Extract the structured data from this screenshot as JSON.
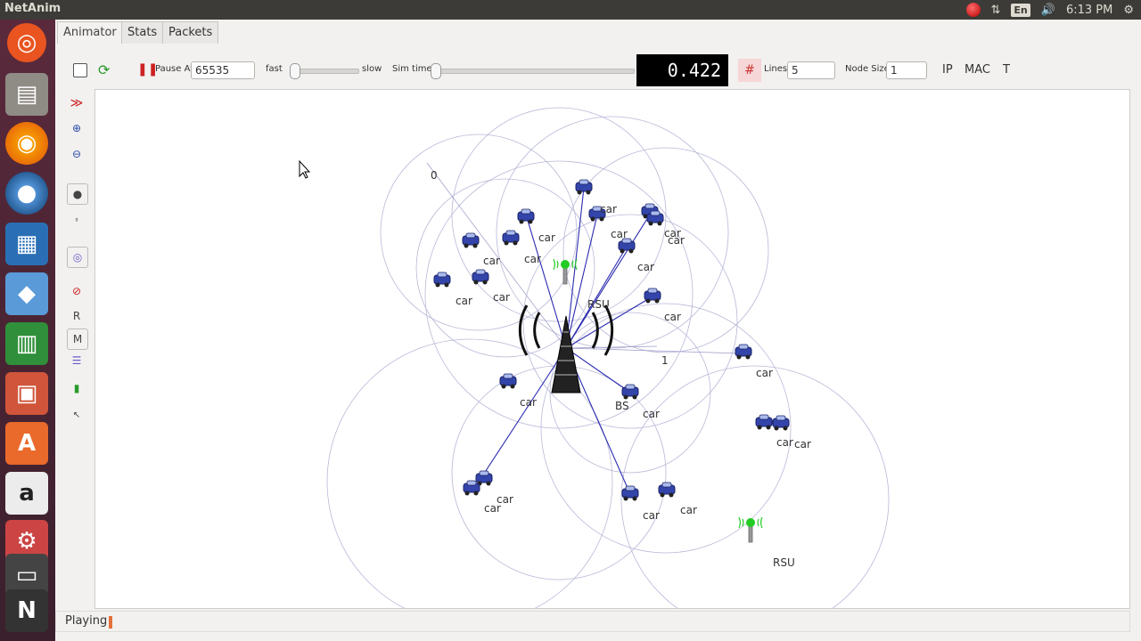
{
  "app": {
    "title": "NetAnim"
  },
  "tray": {
    "lang": "En",
    "time": "6:13 PM"
  },
  "tabs": [
    {
      "label": "Animator"
    },
    {
      "label": "Stats"
    },
    {
      "label": "Packets"
    }
  ],
  "toolbar": {
    "pause_at_label": "Pause At",
    "pause_at_value": "65535",
    "fast_label": "fast",
    "slow_label": "slow",
    "sim_time_label": "Sim time",
    "sim_time_value": "0.422",
    "lines_label": "Lines",
    "lines_value": "5",
    "node_size_label": "Node Size",
    "node_size_value": "1",
    "ip_label": "IP",
    "mac_label": "MAC",
    "t_label": "T"
  },
  "sidebar": {
    "r_label": "R",
    "m_label": "M"
  },
  "scene": {
    "node0_label": "0",
    "node1_label": "1",
    "bs_label": "BS",
    "rsu_label": "RSU",
    "car_label": "car",
    "colors": {
      "link": "#2b2bb0",
      "range": "#b8b8d8",
      "node": "#3344aa",
      "rsu": "#22cc22"
    }
  },
  "status": {
    "text": "Playing"
  }
}
